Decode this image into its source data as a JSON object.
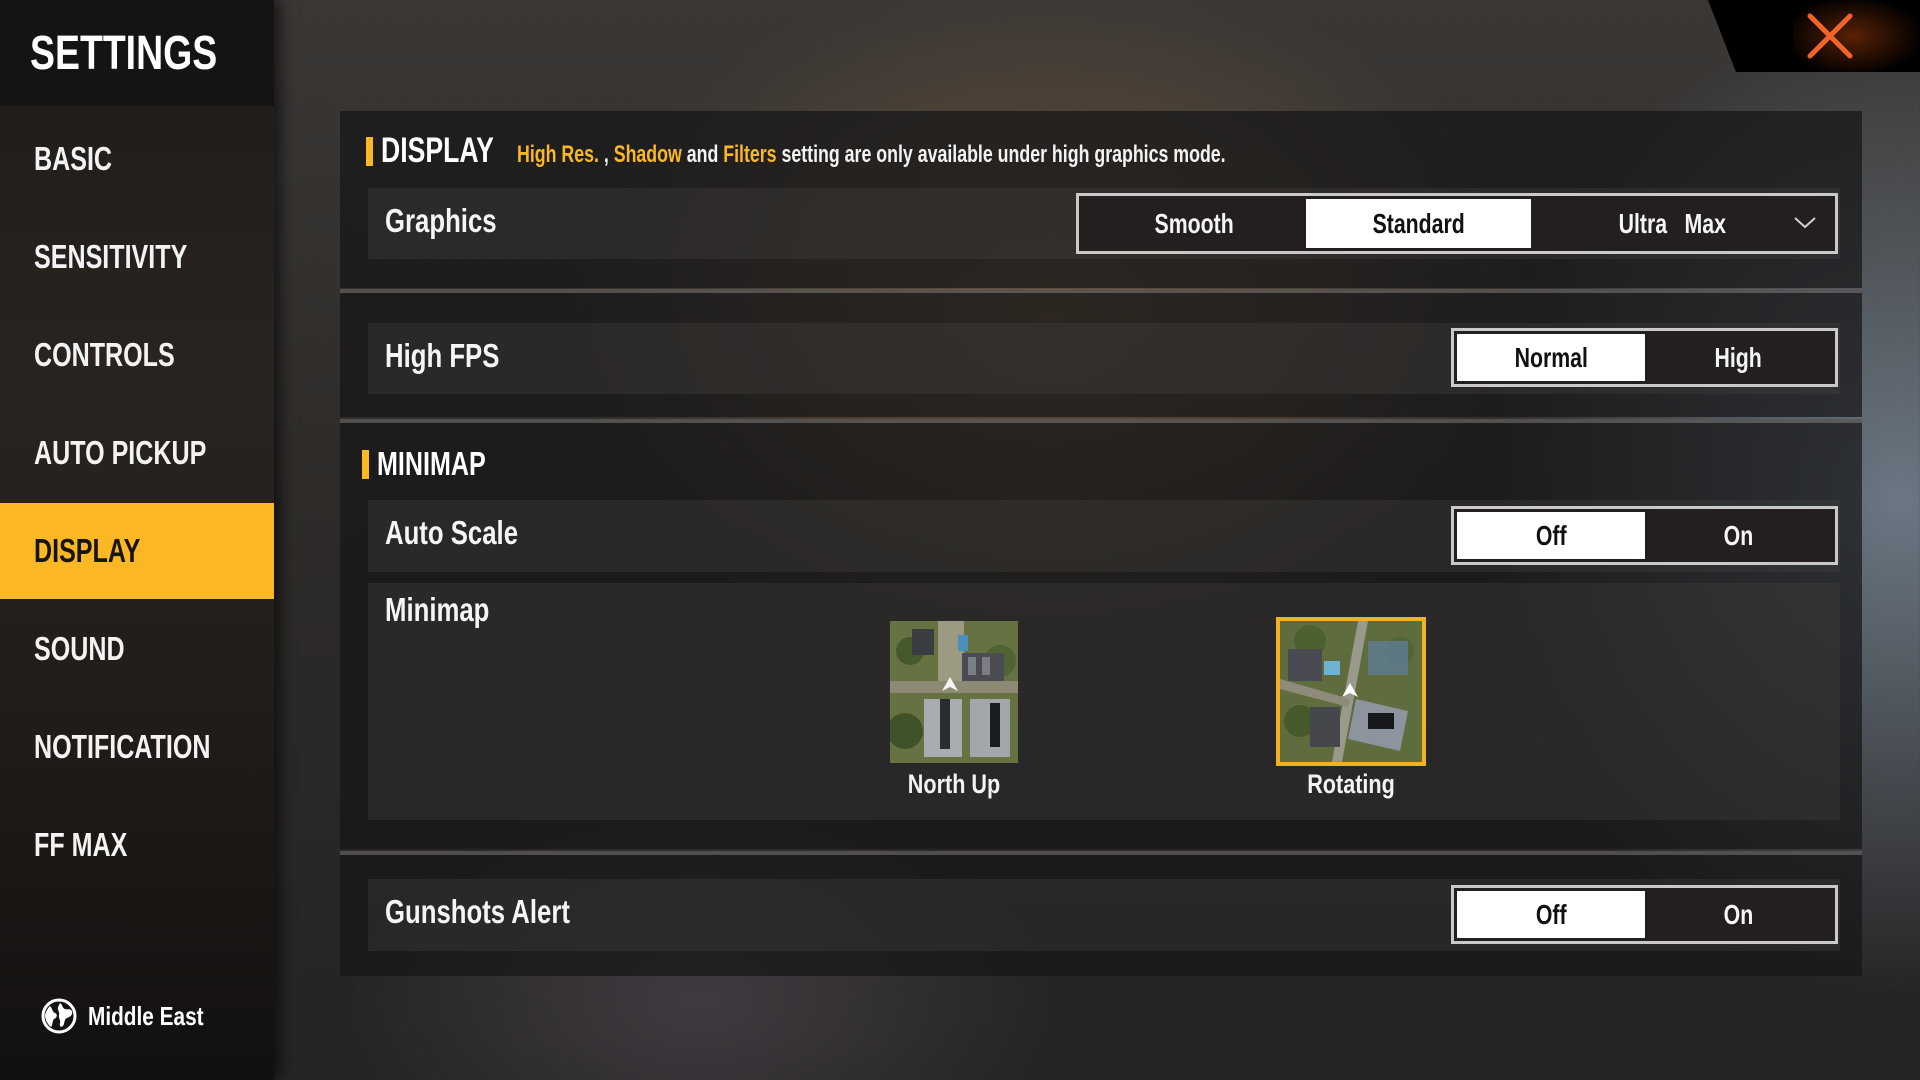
{
  "sidebar": {
    "title": "SETTINGS",
    "items": [
      {
        "label": "BASIC",
        "active": false
      },
      {
        "label": "SENSITIVITY",
        "active": false
      },
      {
        "label": "CONTROLS",
        "active": false
      },
      {
        "label": "AUTO PICKUP",
        "active": false
      },
      {
        "label": "DISPLAY",
        "active": true
      },
      {
        "label": "SOUND",
        "active": false
      },
      {
        "label": "NOTIFICATION",
        "active": false
      },
      {
        "label": "FF MAX",
        "active": false
      }
    ],
    "region": {
      "icon": "globe-icon",
      "label": "Middle East"
    }
  },
  "close": {
    "icon": "close-icon",
    "color": "#f0642a"
  },
  "display_section": {
    "title": "DISPLAY",
    "note": {
      "hl1": "High Res.",
      "sep": " , ",
      "hl2": "Shadow",
      "and": " and ",
      "hl3": "Filters",
      "rest": " setting are only available under high graphics mode."
    }
  },
  "graphics": {
    "label": "Graphics",
    "options": [
      "Smooth",
      "Standard",
      "Ultra",
      "Max"
    ],
    "selected": "Standard",
    "dropdown_icon": "chevron-down-icon"
  },
  "high_fps": {
    "label": "High FPS",
    "options": [
      "Normal",
      "High"
    ],
    "selected": "Normal"
  },
  "minimap_section": {
    "title": "MINIMAP",
    "auto_scale": {
      "label": "Auto Scale",
      "options": [
        "Off",
        "On"
      ],
      "selected": "Off"
    },
    "minimap": {
      "label": "Minimap",
      "options": [
        {
          "label": "North Up",
          "selected": false
        },
        {
          "label": "Rotating",
          "selected": true
        }
      ]
    }
  },
  "gunshots_alert": {
    "label": "Gunshots Alert",
    "options": [
      "Off",
      "On"
    ],
    "selected": "Off"
  },
  "colors": {
    "accent": "#fbb824",
    "selected_segment": "#ffffff",
    "close": "#f0642a"
  }
}
